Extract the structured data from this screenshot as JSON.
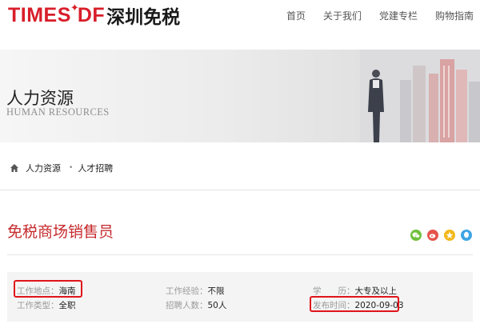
{
  "brand": {
    "times": "TIMES",
    "star": "✦",
    "df": "DF",
    "cn": "深圳免税"
  },
  "nav": [
    "首页",
    "关于我们",
    "党建专栏",
    "购物指南"
  ],
  "banner": {
    "title": "人力资源",
    "subtitle": "HUMAN RESOURCES"
  },
  "breadcrumb": {
    "home_icon": "home-icon",
    "items": [
      "人力资源",
      "人才招聘"
    ],
    "separator": "•"
  },
  "job": {
    "title": "免税商场销售员",
    "share_icons": [
      "wechat-icon",
      "weibo-icon",
      "star-icon",
      "qq-icon"
    ],
    "fields": {
      "location": {
        "label": "工作地点：",
        "value": "海南"
      },
      "type": {
        "label": "工作类型：",
        "value": "全职"
      },
      "experience": {
        "label": "工作经验：",
        "value": "不限"
      },
      "headcount": {
        "label": "招聘人数：",
        "value": "50人"
      },
      "education": {
        "label": "学　　历：",
        "value": "大专及以上"
      },
      "published": {
        "label": "发布时间：",
        "value": "2020-09-03"
      }
    }
  },
  "colors": {
    "brand_red": "#d81e2a",
    "title_red": "#c62b2e",
    "annotation_red": "#e0141a"
  }
}
